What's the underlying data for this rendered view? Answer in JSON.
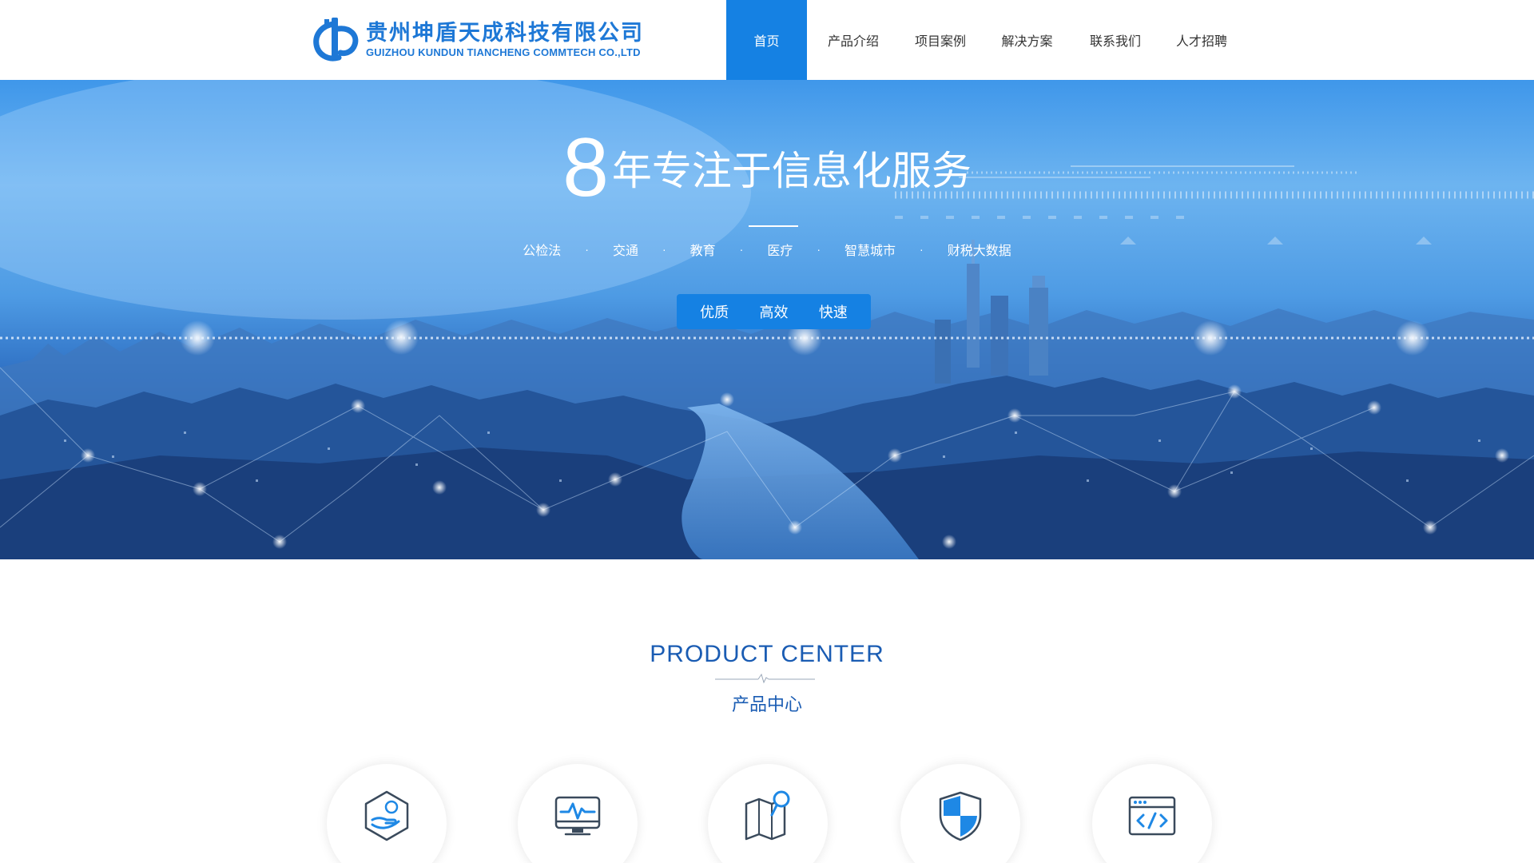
{
  "header": {
    "logo_cn": "贵州坤盾天成科技有限公司",
    "logo_en": "GUIZHOU KUNDUN TIANCHENG COMMTECH CO.,LTD",
    "nav": [
      {
        "label": "首页",
        "active": true
      },
      {
        "label": "产品介绍",
        "active": false
      },
      {
        "label": "项目案例",
        "active": false
      },
      {
        "label": "解决方案",
        "active": false
      },
      {
        "label": "联系我们",
        "active": false
      },
      {
        "label": "人才招聘",
        "active": false
      }
    ]
  },
  "banner": {
    "headline_number": "8",
    "headline_text": "年专注于信息化服务",
    "tags": [
      "公检法",
      "交通",
      "教育",
      "医疗",
      "智慧城市",
      "财税大数据"
    ],
    "tag_separator": "·",
    "pills": [
      "优质",
      "高效",
      "快速"
    ]
  },
  "products": {
    "title_en": "PRODUCT CENTER",
    "title_cn": "产品中心",
    "icons": [
      "hand-coin-icon",
      "monitor-pulse-icon",
      "map-pin-icon",
      "shield-icon",
      "code-window-icon"
    ]
  },
  "colors": {
    "brand": "#1e78d6",
    "nav_active": "#1581e3",
    "section_title": "#1a5cb3"
  }
}
